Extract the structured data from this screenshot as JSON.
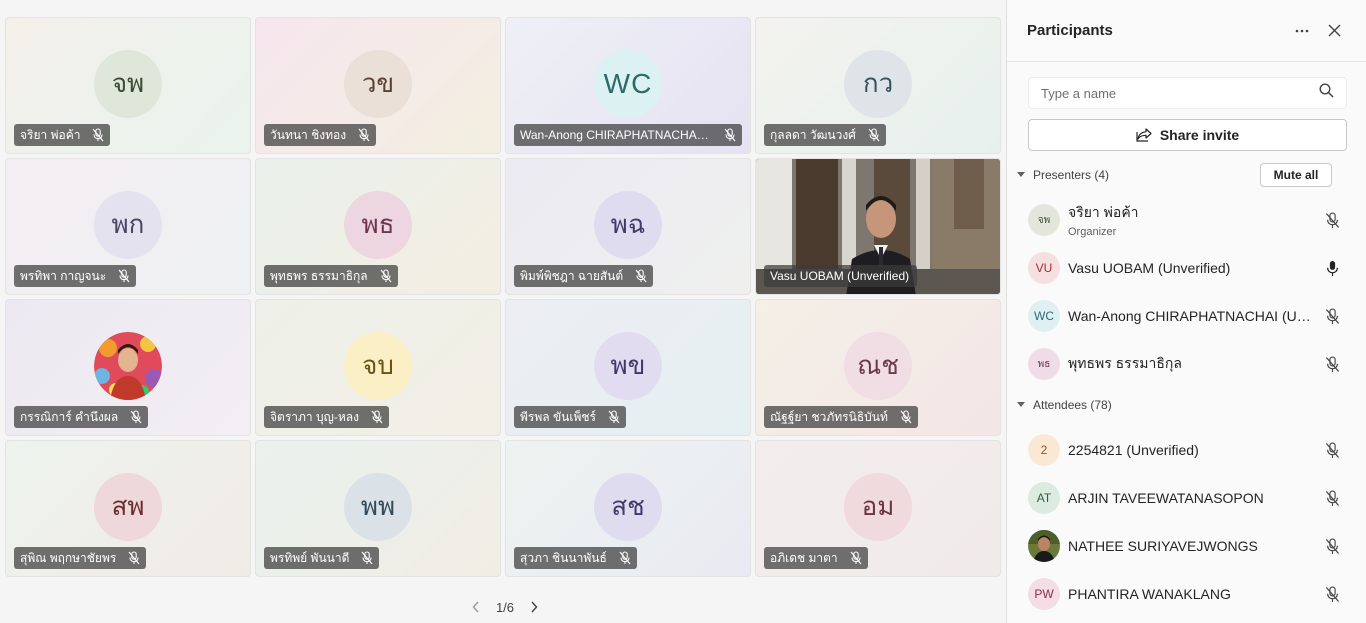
{
  "tiles": [
    {
      "initials": "จพ",
      "name": "จริยา พ่อค้า",
      "bg": "linear-gradient(135deg,#f4f0ea,#e9f3ee)",
      "avatar_bg": "#dfe6da",
      "avatar_color": "#3c4a36"
    },
    {
      "initials": "วข",
      "name": "วันทนา ชิงทอง",
      "bg": "linear-gradient(135deg,#f6e6ee,#f3efe0)",
      "avatar_bg": "#ebe0d8",
      "avatar_color": "#5a4032"
    },
    {
      "initials": "WC",
      "name": "Wan-Anong CHIRAPHATNACHAI ...",
      "bg": "linear-gradient(135deg,#eef0f6,#e6e2f2)",
      "avatar_bg": "#dcf1f1",
      "avatar_color": "#2d6a6a"
    },
    {
      "initials": "กว",
      "name": "กุลลดา วัฒนวงศ์",
      "bg": "linear-gradient(135deg,#f4f2ee,#e6f1ee)",
      "avatar_bg": "#dfe4e8",
      "avatar_color": "#3b4e5c"
    },
    {
      "initials": "พก",
      "name": "พรทิพา กาญจนะ",
      "bg": "linear-gradient(135deg,#f3eef2,#eef0f2)",
      "avatar_bg": "#e4e2ee",
      "avatar_color": "#4b4466"
    },
    {
      "initials": "พธ",
      "name": "พุทธพร ธรรมาธิกุล",
      "bg": "linear-gradient(135deg,#e9f1ec,#f4eee2)",
      "avatar_bg": "#eed6e0",
      "avatar_color": "#6a3650"
    },
    {
      "initials": "พฉ",
      "name": "พิมพ์พิชฎา ฉายสันต์",
      "bg": "linear-gradient(135deg,#eceaf3,#eff0ee)",
      "avatar_bg": "#e0dcef",
      "avatar_color": "#43396a"
    },
    {
      "video": true,
      "name": "Vasu UOBAM (Unverified)"
    },
    {
      "photo": true,
      "name": "กรรณิการ์ คำนึงผล",
      "bg": "linear-gradient(135deg,#ece9f2,#f2eef3)"
    },
    {
      "initials": "จบ",
      "name": "จิตราภา บุญ-หลง",
      "bg": "linear-gradient(135deg,#eef0e9,#f2efe6)",
      "avatar_bg": "#fbefc6",
      "avatar_color": "#6a5316"
    },
    {
      "initials": "พข",
      "name": "พีรพล ขันเพ็ชร์",
      "bg": "linear-gradient(135deg,#eceef3,#e6eff2)",
      "avatar_bg": "#e1dcef",
      "avatar_color": "#42396a"
    },
    {
      "initials": "ณช",
      "name": "ณัฐฐ์ยา ชวภัทรนิธิบันท์",
      "bg": "linear-gradient(135deg,#f5efe6,#f3e6e6)",
      "avatar_bg": "#f1dde4",
      "avatar_color": "#6a3a4c"
    },
    {
      "initials": "สพ",
      "name": "สุพิณ พฤกษาชัยพร",
      "bg": "linear-gradient(135deg,#eef3ee,#f0ebe6)",
      "avatar_bg": "#efd8da",
      "avatar_color": "#6b2e35"
    },
    {
      "initials": "พพ",
      "name": "พรทิพย์ พันนาดี",
      "bg": "linear-gradient(135deg,#eaf1ee,#f1ede4)",
      "avatar_bg": "#dae2e8",
      "avatar_color": "#34495a"
    },
    {
      "initials": "สช",
      "name": "สุวภา ชินนาพันธ์",
      "bg": "linear-gradient(135deg,#edf3f0,#e9eaf3)",
      "avatar_bg": "#e0dcef",
      "avatar_color": "#43396a"
    },
    {
      "initials": "อม",
      "name": "อภิเดช มาตา",
      "bg": "linear-gradient(135deg,#f3eded,#f1eaea)",
      "avatar_bg": "#f0dadd",
      "avatar_color": "#6b3440"
    }
  ],
  "pager": {
    "label": "1/6"
  },
  "panel": {
    "title": "Participants",
    "search_placeholder": "Type a name",
    "share_label": "Share invite",
    "presenters_label": "Presenters (4)",
    "mute_all_label": "Mute all",
    "attendees_label": "Attendees (78)",
    "presenters": [
      {
        "initials": "จพ",
        "name": "จริยา พ่อค้า",
        "role": "Organizer",
        "avatar_bg": "#e4e6dc",
        "avatar_color": "#434d37",
        "mic": "muted",
        "thai": true
      },
      {
        "initials": "VU",
        "name": "Vasu UOBAM (Unverified)",
        "avatar_bg": "#f6dfe0",
        "avatar_color": "#9a2f3a",
        "mic": "on"
      },
      {
        "initials": "WC",
        "name": "Wan-Anong CHIRAPHATNACHAI (Un...",
        "avatar_bg": "#dff0f2",
        "avatar_color": "#2e6b74",
        "mic": "muted"
      },
      {
        "initials": "พธ",
        "name": "พุทธพร ธรรมาธิกุล",
        "avatar_bg": "#f0dce6",
        "avatar_color": "#6a3650",
        "mic": "muted",
        "thai": true
      }
    ],
    "attendees": [
      {
        "initials": "2",
        "name": "2254821 (Unverified)",
        "avatar_bg": "#fbe8d4",
        "avatar_color": "#8a5a1e",
        "mic": "muted"
      },
      {
        "initials": "AT",
        "name": "ARJIN TAVEEWATANASOPON",
        "avatar_bg": "#dcebe0",
        "avatar_color": "#2f5e3c",
        "mic": "muted"
      },
      {
        "photo": true,
        "name": "NATHEE SURIYAVEJWONGS",
        "mic": "muted"
      },
      {
        "initials": "PW",
        "name": "PHANTIRA WANAKLANG",
        "avatar_bg": "#f4dde4",
        "avatar_color": "#8a2f4c",
        "mic": "muted"
      }
    ]
  }
}
